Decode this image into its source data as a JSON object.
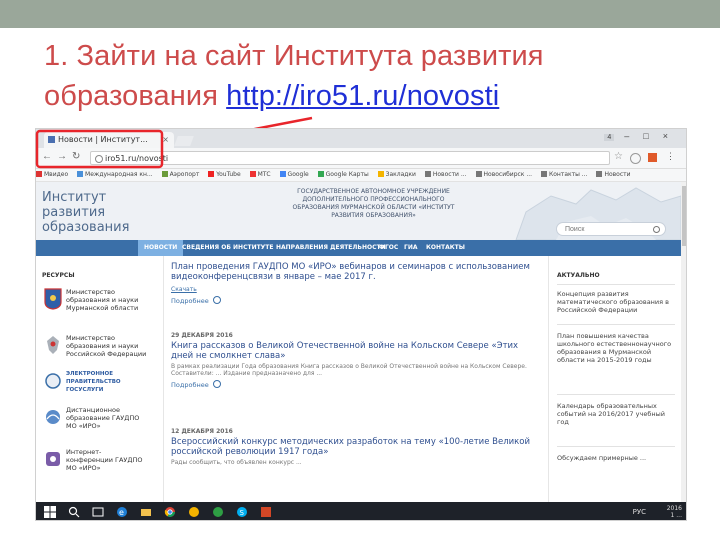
{
  "slide": {
    "title_line1": "1. Зайти на сайт Института развития",
    "title_line2_prefix": "образования ",
    "link_part1": "http://",
    "link_part2": "iro51.ru/novosti",
    "accent_color": "#cd4b4b",
    "link_color": "#1f2fd6",
    "topbar_color": "#9aa79a"
  },
  "browser": {
    "tab_title": "Новости | Институт...",
    "address": "iro51.ru/novosti",
    "window_badge": "4",
    "bookmarks": [
      "Мвидео",
      "Международная кн...",
      "Аэропорт",
      "YouTube",
      "МТС",
      "Google",
      "Google Карты",
      "Закладки",
      "Новости ...",
      "Новосибирск ...",
      "Контакты ...",
      "Новости"
    ]
  },
  "site": {
    "logo": "Институт развития образования",
    "header": "ГОСУДАРСТВЕННОЕ АВТОНОМНОЕ УЧРЕЖДЕНИЕ ДОПОЛНИТЕЛЬНОГО ПРОФЕССИОНАЛЬНОГО ОБРАЗОВАНИЯ МУРМАНСКОЙ ОБЛАСТИ «ИНСТИТУТ РАЗВИТИЯ ОБРАЗОВАНИЯ»",
    "search_placeholder": "Поиск",
    "menu": [
      "НОВОСТИ",
      "СВЕДЕНИЯ ОБ ИНСТИТУТЕ",
      "НАПРАВЛЕНИЯ ДЕЯТЕЛЬНОСТИ",
      "ФГОС",
      "ГИА",
      "КОНТАКТЫ"
    ],
    "resources_heading": "РЕСУРСЫ",
    "resources": [
      {
        "text": "Министерство образования и науки Мурманской области"
      },
      {
        "text": "Министерство образования и науки Российской Федерации"
      },
      {
        "text": "ЭЛЕКТРОННОЕ ПРАВИТЕЛЬСТВО ГОСУСЛУГИ"
      },
      {
        "text": "Дистанционное образование ГАУДПО МО «ИРО»"
      },
      {
        "text": "Интернет-конференции ГАУДПО МО «ИРО»"
      }
    ],
    "news": [
      {
        "date": "",
        "title": "План проведения ГАУДПО МО «ИРО» вебинаров и семинаров с использованием видеоконференцсвязи в январе – мае 2017 г.",
        "body": "",
        "link": "Скачать",
        "more": "Подробнее"
      },
      {
        "date": "29 ДЕКАБРЯ 2016",
        "title": "Книга рассказов о Великой Отечественной войне на Кольском Севере «Этих дней не смолкнет слава»",
        "body": "В рамках реализации Года образования Книга рассказов о Великой Отечественной войне на Кольском Севере. Составители: ... Издание предназначено для ...",
        "link": "",
        "more": "Подробнее"
      },
      {
        "date": "12 ДЕКАБРЯ 2016",
        "title": "Всероссийский конкурс методических разработок на тему «100-летие Великой российской революции 1917 года»",
        "body": "Рады сообщить, что объявлен конкурс ...",
        "link": "",
        "more": ""
      }
    ],
    "actual_heading": "АКТУАЛЬНО",
    "actual": [
      "Концепция развития математического образования в Российской Федерации",
      "План повышения качества школьного естественнонаучного образования в Мурманской области на 2015-2019 годы",
      "Календарь образовательных событий на 2016/2017 учебный год",
      "Обсуждаем примерные ..."
    ]
  },
  "taskbar": {
    "lang": "РУС",
    "time": "2016",
    "date": "1 ..."
  }
}
